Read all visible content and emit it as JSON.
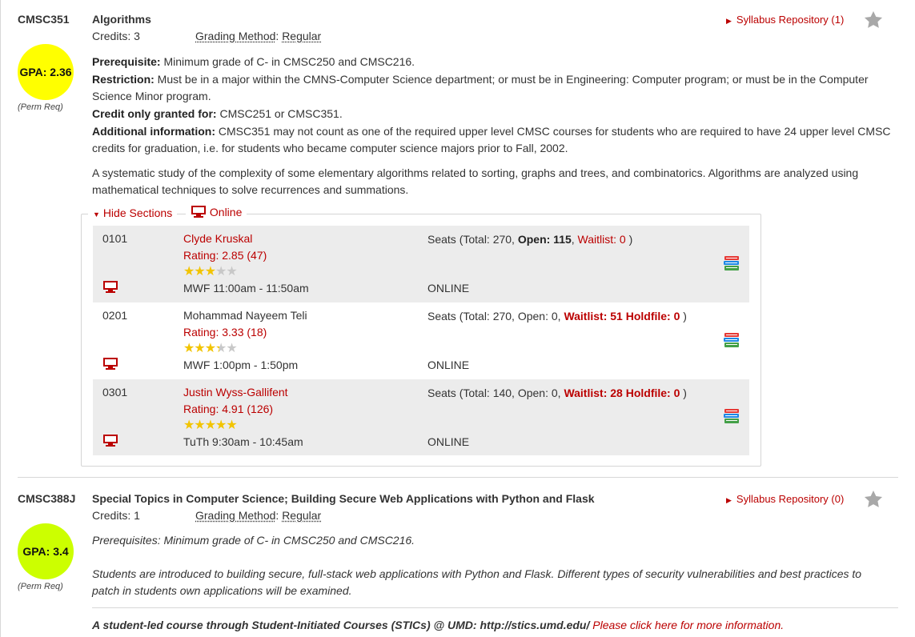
{
  "courses": [
    {
      "code": "CMSC351",
      "title": "Algorithms",
      "credits": "Credits: 3",
      "grading_label": "Grading Method",
      "grading_value": "Regular",
      "gpa": "GPA: 2.36",
      "gpa_color": "#ffff00",
      "perm": "(Perm Req)",
      "syllabus": "Syllabus Repository (1)",
      "prereq_label": "Prerequisite:",
      "prereq": " Minimum grade of C- in CMSC250 and CMSC216.",
      "restriction_label": "Restriction:",
      "restriction": " Must be in a major within the CMNS-Computer Science department; or must be in Engineering: Computer program; or must be in the Computer Science Minor program.",
      "credit_only_label": "Credit only granted for:",
      "credit_only": " CMSC251 or CMSC351.",
      "addl_label": "Additional information:",
      "addl": " CMSC351 may not count as one of the required upper level CMSC courses for students who are required to have 24 upper level CMSC credits for graduation, i.e. for students who became computer science majors prior to Fall, 2002.",
      "description": "A systematic study of the complexity of some elementary algorithms related to sorting, graphs and trees, and combinatorics. Algorithms are analyzed using mathematical techniques to solve recurrences and summations.",
      "hide_sections": "Hide Sections",
      "online": "Online",
      "sections": [
        {
          "number": "0101",
          "instructor": "Clyde Kruskal",
          "rating": "Rating: 2.85 (47)",
          "stars": 3,
          "seats_prefix": "Seats (Total: 270, ",
          "open_text": "Open: 115",
          "sep": ", ",
          "waitlist_text": "Waitlist: 0",
          "seats_suffix": " )",
          "time": "MWF 11:00am - 11:50am",
          "room": "ONLINE"
        },
        {
          "number": "0201",
          "instructor": "Mohammad Nayeem Teli",
          "rating": "Rating: 3.33 (18)",
          "stars": 3.33,
          "seats_prefix": "Seats (Total: 270, Open: 0, ",
          "waitlist_text": "Waitlist: 51 Holdfile: 0",
          "seats_suffix": " )",
          "time": "MWF 1:00pm - 1:50pm",
          "room": "ONLINE"
        },
        {
          "number": "0301",
          "instructor": "Justin Wyss-Gallifent",
          "rating": "Rating: 4.91 (126)",
          "stars": 4.91,
          "seats_prefix": "Seats (Total: 140, Open: 0, ",
          "waitlist_text": "Waitlist: 28 Holdfile: 0",
          "seats_suffix": " )",
          "time": "TuTh 9:30am - 10:45am",
          "room": "ONLINE"
        }
      ]
    },
    {
      "code": "CMSC388J",
      "title": "Special Topics in Computer Science; Building Secure Web Applications with Python and Flask",
      "credits": "Credits: 1",
      "grading_label": "Grading Method",
      "grading_value": "Regular",
      "gpa": "GPA: 3.4",
      "gpa_color": "#ccff00",
      "perm": "(Perm Req)",
      "syllabus": "Syllabus Repository (0)",
      "prereq": "Prerequisites: Minimum grade of C- in CMSC250 and CMSC216.",
      "description": "Students are introduced to building secure, full-stack web applications with Python and Flask. Different types of security vulnerabilities and best practices to patch in students own applications will be examined.",
      "stics": "A student-led course through Student-Initiated Courses (STICs) @ UMD: http://stics.umd.edu/",
      "stics_link": "Please click here for more information."
    }
  ],
  "colors": {
    "accent": "#bb0000",
    "row_shade": "#ececec",
    "star_on": "#f2c400"
  }
}
